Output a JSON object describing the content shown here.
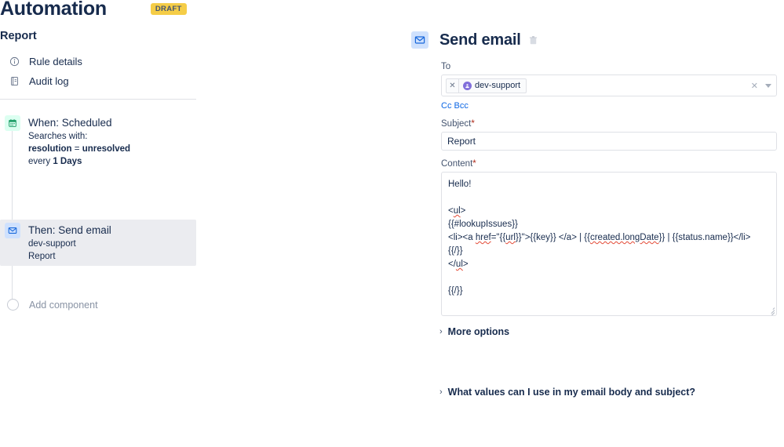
{
  "header": {
    "title": "Automation",
    "badge": "DRAFT"
  },
  "sidebar": {
    "rule_name": "Report",
    "nav": [
      {
        "label": "Rule details",
        "icon": "info-circle-icon"
      },
      {
        "label": "Audit log",
        "icon": "audit-log-icon"
      }
    ],
    "components": [
      {
        "title": "When: Scheduled",
        "icon": "calendar-icon",
        "lines": [
          {
            "text": "Searches with:"
          },
          {
            "parts": [
              {
                "t": "resolution",
                "b": true
              },
              {
                "t": " = "
              },
              {
                "t": "unresolved",
                "b": true
              }
            ]
          },
          {
            "parts": [
              {
                "t": "every "
              },
              {
                "t": "1 Days",
                "b": true
              }
            ]
          }
        ]
      },
      {
        "title": "Then: Send email",
        "icon": "email-icon",
        "lines": [
          {
            "text": "dev-support"
          },
          {
            "text": "Report"
          }
        ]
      }
    ],
    "add_component_label": "Add component"
  },
  "detail": {
    "title": "Send email",
    "icon": "email-icon",
    "delete_icon": "trash-icon",
    "to": {
      "label": "To",
      "chip": {
        "label": "dev-support",
        "avatar": "user-avatar-icon",
        "remove_icon": "close-icon"
      },
      "clear_icon": "clear-icon",
      "caret_icon": "chevron-down-icon"
    },
    "cc_label": "Cc",
    "bcc_label": "Bcc",
    "subject": {
      "label": "Subject",
      "required_mark": "*",
      "value": "Report",
      "placeholder": ""
    },
    "content": {
      "label": "Content",
      "required_mark": "*",
      "lines": {
        "l1": "Hello!",
        "l2": "",
        "l3_open": "<",
        "l3_tag": "ul",
        "l3_close": ">",
        "l4": "{{#lookupIssues}}",
        "l5_a": "<li><a ",
        "l5_href": "href",
        "l5_b": "=\"{{",
        "l5_url": "url",
        "l5_c": "}}\">{{key}} </a> | {{",
        "l5_created": "created.longDate",
        "l5_d": "}} | {{status.name}}</li>",
        "l6": "{{/}}",
        "l7_open": "</",
        "l7_tag": "ul",
        "l7_close": ">",
        "l8": "",
        "l9": "{{/}}"
      }
    },
    "more_options_label": "More options",
    "faq_label": "What values can I use in my email body and subject?",
    "chevron": "›"
  },
  "colors": {
    "badge_bg": "#f5cd47",
    "accent_blue": "#0c66e4",
    "trigger_green": "#22a06b",
    "action_blue": "#1868db",
    "required_red": "#ae2a19",
    "avatar_purple": "#8270db"
  }
}
